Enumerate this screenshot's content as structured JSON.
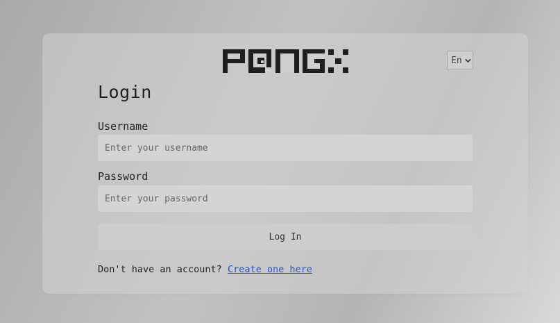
{
  "brand": {
    "logo_text": "PONGX"
  },
  "language": {
    "selected": "En"
  },
  "login": {
    "title": "Login",
    "username_label": "Username",
    "username_placeholder": "Enter your username",
    "password_label": "Password",
    "password_placeholder": "Enter your password",
    "submit_label": "Log In",
    "signup_prompt": "Don't have an account?",
    "signup_link": "Create one here"
  },
  "icons": {
    "language_dropdown": "chevron-down-icon"
  }
}
